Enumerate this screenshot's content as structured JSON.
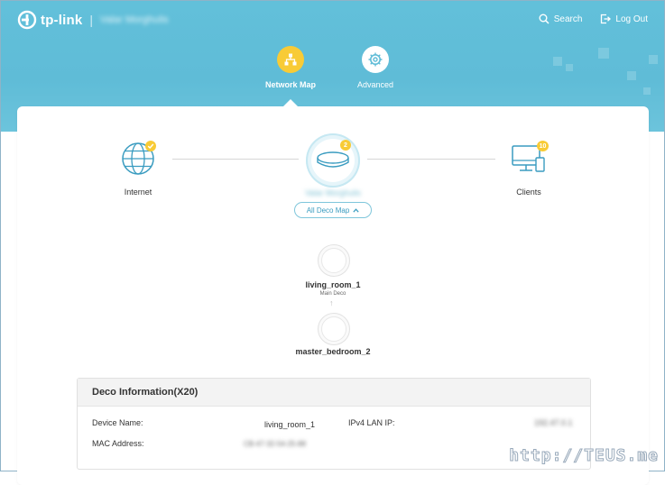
{
  "header": {
    "brand": "tp-link",
    "network_name": "Valar Morghulis",
    "search_label": "Search",
    "logout_label": "Log Out"
  },
  "nav": {
    "tabs": [
      {
        "label": "Network Map",
        "icon": "network-map-icon",
        "active": true
      },
      {
        "label": "Advanced",
        "icon": "gear-icon",
        "active": false
      }
    ]
  },
  "topology": {
    "internet_label": "Internet",
    "main_network_name": "Valar Morghulis",
    "main_badge": "2",
    "clients_label": "Clients",
    "clients_badge": "10",
    "all_deco_map_label": "All Deco Map"
  },
  "decos": [
    {
      "name": "living_room_1",
      "role": "Main Deco"
    },
    {
      "name": "master_bedroom_2",
      "role": ""
    }
  ],
  "info": {
    "title": "Deco Information(X20)",
    "device_name_label": "Device Name:",
    "device_name_value": "living_room_1",
    "mac_label": "MAC Address:",
    "mac_value": "CB-47-32-54-25-88",
    "ipv4_label": "IPv4 LAN IP:",
    "ipv4_value": "192.47.0.1"
  },
  "watermark": "http://TEUS.me",
  "colors": {
    "header_bg": "#62c0da",
    "accent_yellow": "#f8cb36",
    "accent_blue": "#3a9cc0"
  }
}
